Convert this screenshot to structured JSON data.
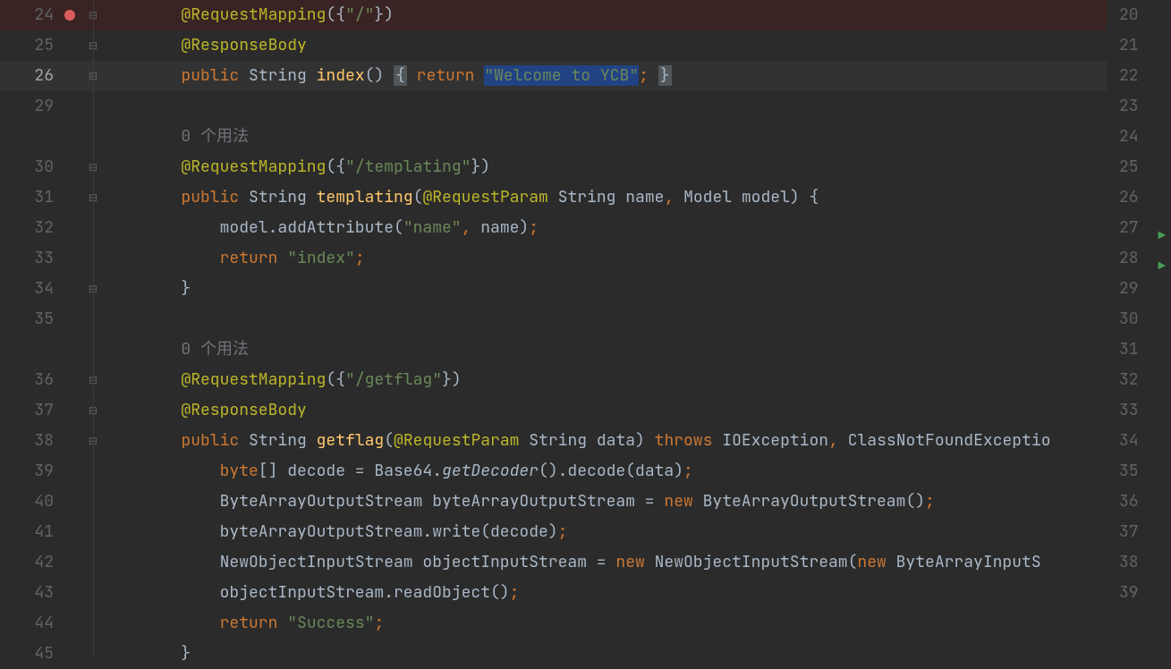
{
  "leftLines": [
    {
      "n": "24",
      "bp": true,
      "fold": "⊟",
      "hl": true,
      "tokens": [
        {
          "t": "        ",
          "c": ""
        },
        {
          "t": "@RequestMapping",
          "c": "anno"
        },
        {
          "t": "({",
          "c": ""
        },
        {
          "t": "\"/\"",
          "c": "str"
        },
        {
          "t": "})",
          "c": ""
        }
      ]
    },
    {
      "n": "25",
      "fold": "⊟",
      "tokens": [
        {
          "t": "        ",
          "c": ""
        },
        {
          "t": "@ResponseBody",
          "c": "anno"
        }
      ]
    },
    {
      "n": "26",
      "fold": "⊞",
      "cur": true,
      "tokens": [
        {
          "t": "        ",
          "c": ""
        },
        {
          "t": "public",
          "c": "kw"
        },
        {
          "t": " String ",
          "c": ""
        },
        {
          "t": "index",
          "c": "mth"
        },
        {
          "t": "() ",
          "c": ""
        },
        {
          "t": "{",
          "c": "box"
        },
        {
          "t": " ",
          "c": ""
        },
        {
          "t": "return",
          "c": "kw"
        },
        {
          "t": " ",
          "c": ""
        },
        {
          "t": "\"Welcome to YCB\"",
          "c": "str sel"
        },
        {
          "t": ";",
          "c": "kw"
        },
        {
          "t": " ",
          "c": ""
        },
        {
          "t": "}",
          "c": "box"
        }
      ]
    },
    {
      "n": "29",
      "tokens": []
    },
    {
      "n": "",
      "hint": true,
      "tokens": [
        {
          "t": "        0 个用法",
          "c": "hint"
        }
      ]
    },
    {
      "n": "30",
      "fold": "⊟",
      "tokens": [
        {
          "t": "        ",
          "c": ""
        },
        {
          "t": "@RequestMapping",
          "c": "anno"
        },
        {
          "t": "({",
          "c": ""
        },
        {
          "t": "\"/templating\"",
          "c": "str"
        },
        {
          "t": "})",
          "c": ""
        }
      ]
    },
    {
      "n": "31",
      "fold": "⊟",
      "tokens": [
        {
          "t": "        ",
          "c": ""
        },
        {
          "t": "public",
          "c": "kw"
        },
        {
          "t": " String ",
          "c": ""
        },
        {
          "t": "templating",
          "c": "mth"
        },
        {
          "t": "(",
          "c": ""
        },
        {
          "t": "@RequestParam",
          "c": "anno"
        },
        {
          "t": " String name",
          "c": ""
        },
        {
          "t": ",",
          "c": "kw"
        },
        {
          "t": " Model model) {",
          "c": ""
        }
      ]
    },
    {
      "n": "32",
      "tokens": [
        {
          "t": "            model.addAttribute(",
          "c": ""
        },
        {
          "t": "\"name\"",
          "c": "str"
        },
        {
          "t": ",",
          "c": "kw"
        },
        {
          "t": " name)",
          "c": ""
        },
        {
          "t": ";",
          "c": "kw"
        }
      ]
    },
    {
      "n": "33",
      "tokens": [
        {
          "t": "            ",
          "c": ""
        },
        {
          "t": "return",
          "c": "kw"
        },
        {
          "t": " ",
          "c": ""
        },
        {
          "t": "\"index\"",
          "c": "str"
        },
        {
          "t": ";",
          "c": "kw"
        }
      ]
    },
    {
      "n": "34",
      "fold": "⊟",
      "tokens": [
        {
          "t": "        }",
          "c": ""
        }
      ]
    },
    {
      "n": "35",
      "tokens": []
    },
    {
      "n": "",
      "hint": true,
      "tokens": [
        {
          "t": "        0 个用法",
          "c": "hint"
        }
      ]
    },
    {
      "n": "36",
      "fold": "⊟",
      "tokens": [
        {
          "t": "        ",
          "c": ""
        },
        {
          "t": "@RequestMapping",
          "c": "anno"
        },
        {
          "t": "({",
          "c": ""
        },
        {
          "t": "\"/getflag\"",
          "c": "str"
        },
        {
          "t": "})",
          "c": ""
        }
      ]
    },
    {
      "n": "37",
      "fold": "⊟",
      "tokens": [
        {
          "t": "        ",
          "c": ""
        },
        {
          "t": "@ResponseBody",
          "c": "anno"
        }
      ]
    },
    {
      "n": "38",
      "fold": "⊟",
      "tokens": [
        {
          "t": "        ",
          "c": ""
        },
        {
          "t": "public",
          "c": "kw"
        },
        {
          "t": " String ",
          "c": ""
        },
        {
          "t": "getflag",
          "c": "mth"
        },
        {
          "t": "(",
          "c": ""
        },
        {
          "t": "@RequestParam",
          "c": "anno"
        },
        {
          "t": " String data) ",
          "c": ""
        },
        {
          "t": "throws",
          "c": "kw"
        },
        {
          "t": " IOException",
          "c": ""
        },
        {
          "t": ",",
          "c": "kw"
        },
        {
          "t": " ClassNotFoundExceptio",
          "c": ""
        }
      ]
    },
    {
      "n": "39",
      "tokens": [
        {
          "t": "            ",
          "c": ""
        },
        {
          "t": "byte",
          "c": "kw"
        },
        {
          "t": "[] decode = Base64.",
          "c": ""
        },
        {
          "t": "getDecoder",
          "c": "sta"
        },
        {
          "t": "().decode(data)",
          "c": ""
        },
        {
          "t": ";",
          "c": "kw"
        }
      ]
    },
    {
      "n": "40",
      "tokens": [
        {
          "t": "            ByteArrayOutputStream byteArrayOutputStream = ",
          "c": ""
        },
        {
          "t": "new",
          "c": "kw"
        },
        {
          "t": " ByteArrayOutputStream()",
          "c": ""
        },
        {
          "t": ";",
          "c": "kw"
        }
      ]
    },
    {
      "n": "41",
      "tokens": [
        {
          "t": "            byteArrayOutputStream.write(decode)",
          "c": ""
        },
        {
          "t": ";",
          "c": "kw"
        }
      ]
    },
    {
      "n": "42",
      "tokens": [
        {
          "t": "            NewObjectInputStream objectInputStream = ",
          "c": ""
        },
        {
          "t": "new",
          "c": "kw"
        },
        {
          "t": " NewObjectInputStream(",
          "c": ""
        },
        {
          "t": "new",
          "c": "kw"
        },
        {
          "t": " ByteArrayInputS",
          "c": ""
        }
      ]
    },
    {
      "n": "43",
      "tokens": [
        {
          "t": "            objectInputStream.readObject()",
          "c": ""
        },
        {
          "t": ";",
          "c": "kw"
        }
      ]
    },
    {
      "n": "44",
      "tokens": [
        {
          "t": "            ",
          "c": ""
        },
        {
          "t": "return",
          "c": "kw"
        },
        {
          "t": " ",
          "c": ""
        },
        {
          "t": "\"Success\"",
          "c": "str"
        },
        {
          "t": ";",
          "c": "kw"
        }
      ]
    },
    {
      "n": "45",
      "tokens": [
        {
          "t": "        }",
          "c": ""
        }
      ]
    }
  ],
  "rightLines": [
    {
      "n": "20"
    },
    {
      "n": "21"
    },
    {
      "n": "22"
    },
    {
      "n": "23"
    },
    {
      "n": "24"
    },
    {
      "n": "25"
    },
    {
      "n": "26"
    },
    {
      "n": "27",
      "run": true
    },
    {
      "n": "28",
      "run": true
    },
    {
      "n": "29"
    },
    {
      "n": "30"
    },
    {
      "n": "31"
    },
    {
      "n": "32"
    },
    {
      "n": "33"
    },
    {
      "n": "34"
    },
    {
      "n": "35"
    },
    {
      "n": "36"
    },
    {
      "n": "37"
    },
    {
      "n": "38"
    },
    {
      "n": "39"
    }
  ],
  "scrollbar": {
    "top": "3%",
    "height": "55%",
    "color": "#4e5254",
    "mark": {
      "top": "25%",
      "color": "#a9734a"
    }
  }
}
